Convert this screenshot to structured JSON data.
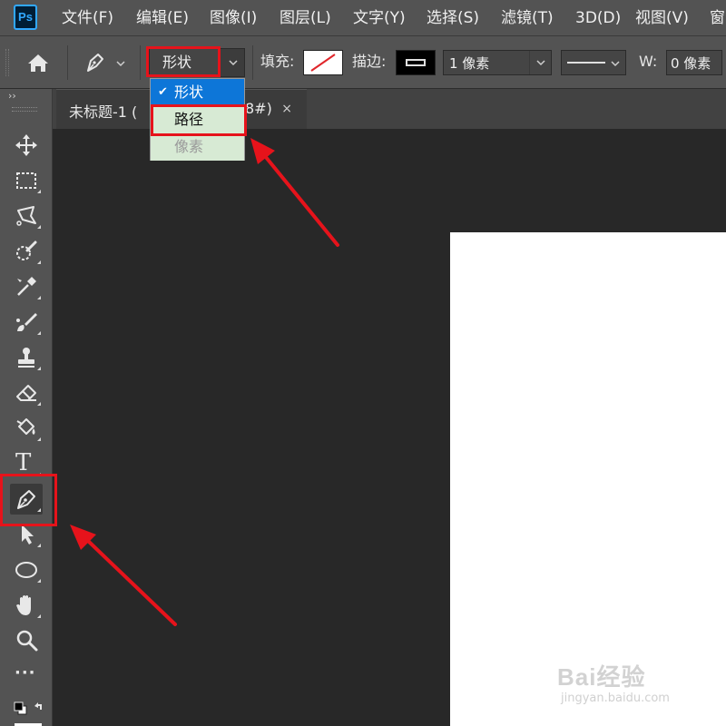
{
  "app": {
    "logo_text": "Ps"
  },
  "menu": {
    "items": [
      "文件(F)",
      "编辑(E)",
      "图像(I)",
      "图层(L)",
      "文字(Y)",
      "选择(S)",
      "滤镜(T)",
      "3D(D)",
      "视图(V)",
      "窗"
    ]
  },
  "options_bar": {
    "mode_value": "形状",
    "fill_label": "填充:",
    "stroke_label": "描边:",
    "stroke_width": "1 像素",
    "w_label": "W:",
    "w_value": "0 像素"
  },
  "mode_dropdown": {
    "options": [
      {
        "label": "形状",
        "checked": true
      },
      {
        "label": "路径",
        "checked": false
      },
      {
        "label": "像素",
        "checked": false,
        "disabled": true
      }
    ]
  },
  "document": {
    "tab_title": "未标题-1 (",
    "tab_title_suffix": "8#)",
    "close_glyph": "×"
  },
  "toolbar": {
    "collapse_glyph": "››",
    "tools": [
      "move-icon",
      "marquee-icon",
      "lasso-icon",
      "quick-select-icon",
      "eyedropper-icon",
      "brush-icon",
      "stamp-icon",
      "eraser-icon",
      "paint-bucket-icon",
      "type-icon",
      "pen-icon",
      "path-select-icon",
      "ellipse-icon",
      "hand-icon",
      "zoom-icon",
      "more-icon"
    ],
    "active_tool": "pen-icon",
    "type_glyph": "T",
    "more_glyph": "···"
  },
  "annotations": {
    "color": "#e6131b"
  },
  "watermark": {
    "brand": "Bai经验",
    "url": "jingyan.baidu.com"
  }
}
